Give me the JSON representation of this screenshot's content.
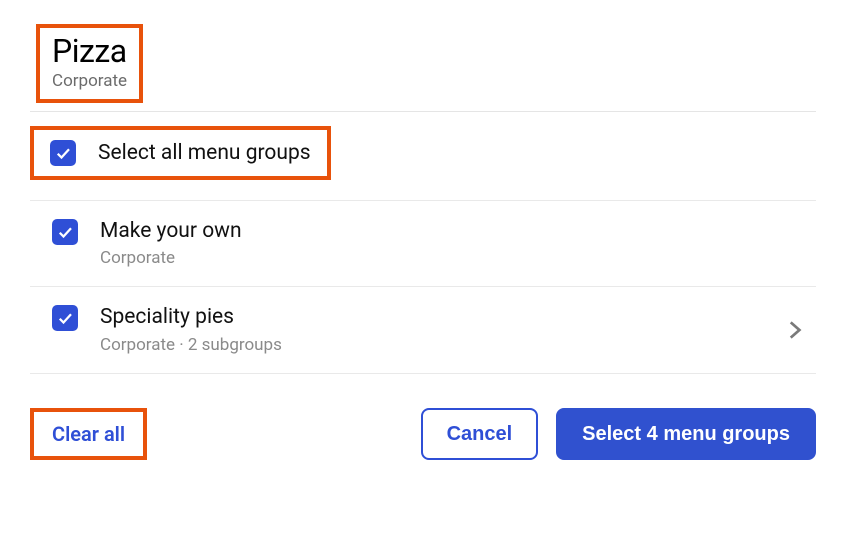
{
  "header": {
    "title": "Pizza",
    "subtitle": "Corporate"
  },
  "selectAll": {
    "label": "Select all menu groups",
    "checked": true
  },
  "items": [
    {
      "title": "Make your own",
      "subtitle": "Corporate",
      "checked": true,
      "hasChevron": false
    },
    {
      "title": "Speciality pies",
      "subtitle": "Corporate · 2 subgroups",
      "checked": true,
      "hasChevron": true
    }
  ],
  "footer": {
    "clearAll": "Clear all",
    "cancel": "Cancel",
    "select": "Select 4 menu groups"
  }
}
